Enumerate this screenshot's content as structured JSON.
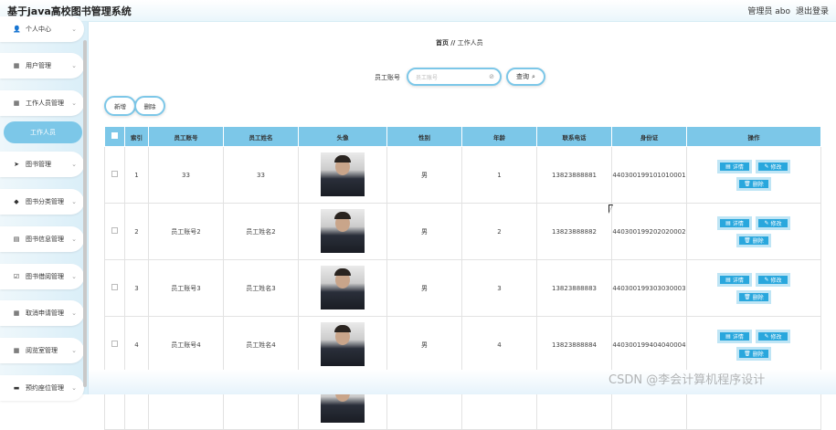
{
  "header": {
    "title": "基于java高校图书管理系统",
    "user": "管理员 abo",
    "logout": "退出登录"
  },
  "sidebar": {
    "items": [
      {
        "label": "个人中心",
        "icon": "person-icon",
        "glyph": "👤"
      },
      {
        "label": "用户管理",
        "icon": "grid-icon",
        "glyph": "▦"
      },
      {
        "label": "工作人员管理",
        "icon": "grid-icon",
        "glyph": "▦"
      },
      {
        "label": "工作人员",
        "icon": "",
        "glyph": ""
      },
      {
        "label": "图书管理",
        "icon": "send-icon",
        "glyph": "➤"
      },
      {
        "label": "图书分类管理",
        "icon": "tag-icon",
        "glyph": "◆"
      },
      {
        "label": "图书信息管理",
        "icon": "doc-icon",
        "glyph": "▤"
      },
      {
        "label": "图书借阅管理",
        "icon": "check-icon",
        "glyph": "☑"
      },
      {
        "label": "取消申请管理",
        "icon": "grid-icon",
        "glyph": "▦"
      },
      {
        "label": "阅览室管理",
        "icon": "grid-icon",
        "glyph": "▦"
      },
      {
        "label": "预约座位管理",
        "icon": "chat-icon",
        "glyph": "▬"
      }
    ]
  },
  "breadcrumb": {
    "home": "首页",
    "sep": "//",
    "current": "工作人员"
  },
  "search": {
    "label": "员工账号",
    "placeholder": "员工账号",
    "button": "查询"
  },
  "actions": {
    "add": "新增",
    "delete": "删除"
  },
  "table": {
    "columns": [
      "索引",
      "员工账号",
      "员工姓名",
      "头像",
      "性别",
      "年龄",
      "联系电话",
      "身份证",
      "操作"
    ],
    "rows": [
      {
        "index": "1",
        "account": "33",
        "name": "33",
        "gender": "男",
        "age": "1",
        "phone": "13823888881",
        "id": "440300199101010001"
      },
      {
        "index": "2",
        "account": "员工账号2",
        "name": "员工姓名2",
        "gender": "男",
        "age": "2",
        "phone": "13823888882",
        "id": "440300199202020002"
      },
      {
        "index": "3",
        "account": "员工账号3",
        "name": "员工姓名3",
        "gender": "男",
        "age": "3",
        "phone": "13823888883",
        "id": "440300199303030003"
      },
      {
        "index": "4",
        "account": "员工账号4",
        "name": "员工姓名4",
        "gender": "男",
        "age": "4",
        "phone": "13823888884",
        "id": "440300199404040004"
      }
    ],
    "ops": {
      "detail": "详情",
      "edit": "修改",
      "delete": "删除"
    }
  },
  "watermark": "CSDN @李会计算机程序设计",
  "colors": {
    "accent": "#7cc7e8",
    "button": "#29a7dd"
  }
}
